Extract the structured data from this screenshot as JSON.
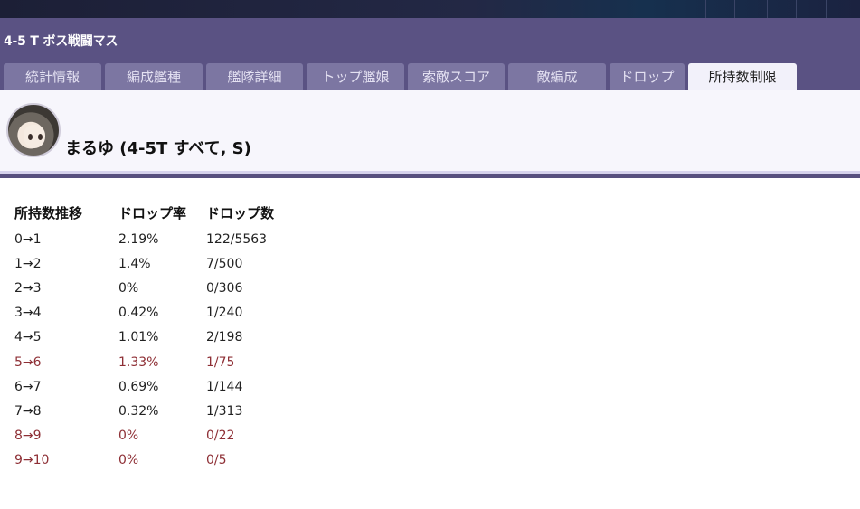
{
  "header": {
    "title": "4-5 T ボス戦闘マス"
  },
  "tabs": [
    {
      "label": "統計情報",
      "active": false
    },
    {
      "label": "編成艦種",
      "active": false
    },
    {
      "label": "艦隊詳細",
      "active": false
    },
    {
      "label": "トップ艦娘",
      "active": false
    },
    {
      "label": "索敵スコア",
      "active": false
    },
    {
      "label": "敵編成",
      "active": false
    },
    {
      "label": "ドロップ",
      "active": false
    },
    {
      "label": "所持数制限",
      "active": true
    }
  ],
  "character": {
    "name": "まるゆ (4-5T すべて, S)"
  },
  "table": {
    "headers": [
      "所持数推移",
      "ドロップ率",
      "ドロップ数"
    ],
    "rows": [
      {
        "transition": "0→1",
        "rate": "2.19%",
        "count": "122/5563",
        "highlight": false
      },
      {
        "transition": "1→2",
        "rate": "1.4%",
        "count": "7/500",
        "highlight": false
      },
      {
        "transition": "2→3",
        "rate": "0%",
        "count": "0/306",
        "highlight": false
      },
      {
        "transition": "3→4",
        "rate": "0.42%",
        "count": "1/240",
        "highlight": false
      },
      {
        "transition": "4→5",
        "rate": "1.01%",
        "count": "2/198",
        "highlight": false
      },
      {
        "transition": "5→6",
        "rate": "1.33%",
        "count": "1/75",
        "highlight": true
      },
      {
        "transition": "6→7",
        "rate": "0.69%",
        "count": "1/144",
        "highlight": false
      },
      {
        "transition": "7→8",
        "rate": "0.32%",
        "count": "1/313",
        "highlight": false
      },
      {
        "transition": "8→9",
        "rate": "0%",
        "count": "0/22",
        "highlight": true
      },
      {
        "transition": "9→10",
        "rate": "0%",
        "count": "0/5",
        "highlight": true
      }
    ]
  },
  "colors": {
    "header_bg": "#5a5283",
    "tab_bg": "#7c76a2",
    "active_tab_bg": "#f2f1fa",
    "highlight_text": "#8e2f35"
  }
}
